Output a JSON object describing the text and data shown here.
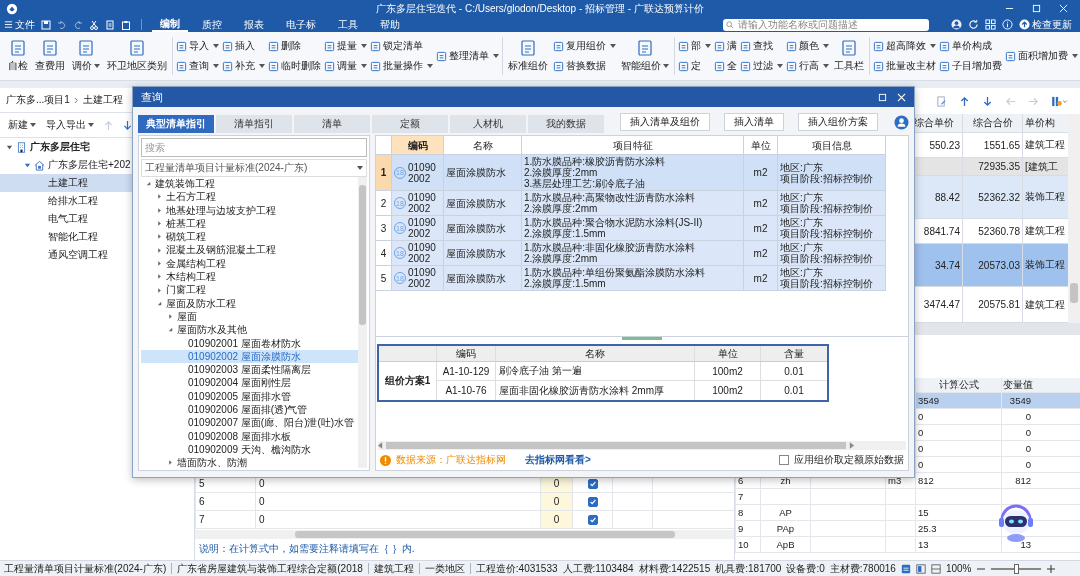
{
  "window": {
    "title": "广东多层住宅迭代 - C:/Users/glodon/Desktop - 招标管理 - 广联达预算计价"
  },
  "menu_bar": {
    "file": "文件",
    "tabs": [
      {
        "label": "编制",
        "selected": true
      },
      {
        "label": "质控",
        "selected": false
      },
      {
        "label": "报表",
        "selected": false
      },
      {
        "label": "电子标",
        "selected": false
      },
      {
        "label": "工具",
        "selected": false
      },
      {
        "label": "帮助",
        "selected": false
      }
    ],
    "search": {
      "placeholder": "请输入功能名称或问题描述"
    },
    "update_button": "检查更新"
  },
  "ribbon": {
    "groups": [
      [
        {
          "kind": "large",
          "label": "自检",
          "dropdown": false
        },
        {
          "kind": "large",
          "label": "查费用",
          "dropdown": false
        },
        {
          "kind": "large",
          "label": "调价",
          "dropdown": true
        },
        {
          "kind": "large",
          "label": "环卫地区类别",
          "dropdown": false
        }
      ],
      [
        {
          "kind": "stack",
          "items": [
            {
              "label": "导入",
              "dropdown": true
            },
            {
              "label": "查询",
              "dropdown": true
            }
          ]
        },
        {
          "kind": "stack",
          "items": [
            {
              "label": "插入",
              "dropdown": false
            },
            {
              "label": "补充",
              "dropdown": true
            }
          ]
        },
        {
          "kind": "stack",
          "items": [
            {
              "label": "删除",
              "dropdown": false
            },
            {
              "label": "临时删除",
              "dropdown": false
            }
          ]
        },
        {
          "kind": "stack",
          "items": [
            {
              "label": "提量",
              "dropdown": true
            },
            {
              "label": "调量",
              "dropdown": true
            }
          ]
        },
        {
          "kind": "stack",
          "items": [
            {
              "label": "锁定清单",
              "dropdown": false
            },
            {
              "label": "批量操作",
              "dropdown": true
            }
          ]
        },
        {
          "kind": "stack",
          "items": [
            {
              "label": "整理清单",
              "dropdown": true
            }
          ]
        }
      ],
      [
        {
          "kind": "large",
          "label": "标准组价",
          "dropdown": false
        },
        {
          "kind": "stack",
          "items": [
            {
              "label": "复用组价",
              "dropdown": true
            },
            {
              "label": "替换数据",
              "dropdown": false
            }
          ]
        },
        {
          "kind": "large",
          "label": "智能组价",
          "dropdown": true
        }
      ],
      [
        {
          "kind": "stack",
          "items": [
            {
              "label": "部",
              "dropdown": true
            },
            {
              "label": "定",
              "dropdown": false
            }
          ]
        },
        {
          "kind": "stack",
          "items": [
            {
              "label": "满",
              "dropdown": false
            },
            {
              "label": "全",
              "dropdown": false
            }
          ]
        },
        {
          "kind": "stack",
          "items": [
            {
              "label": "查找",
              "dropdown": false
            },
            {
              "label": "过滤",
              "dropdown": true
            }
          ]
        },
        {
          "kind": "stack",
          "items": [
            {
              "label": "颜色",
              "dropdown": true
            },
            {
              "label": "行高",
              "dropdown": true
            }
          ]
        },
        {
          "kind": "large",
          "label": "工具栏",
          "dropdown": false
        }
      ],
      [
        {
          "kind": "stack",
          "items": [
            {
              "label": "超高降效",
              "dropdown": true
            },
            {
              "label": "批量改主材",
              "dropdown": false
            }
          ]
        },
        {
          "kind": "stack",
          "items": [
            {
              "label": "单价构成",
              "dropdown": false
            },
            {
              "label": "子目增加费",
              "dropdown": false
            }
          ]
        },
        {
          "kind": "stack",
          "items": [
            {
              "label": "面积增加费",
              "dropdown": true
            }
          ]
        }
      ]
    ]
  },
  "project": {
    "breadcrumb": [
      "广东多...项目1",
      "土建工程"
    ],
    "new_button": "新建",
    "import_button": "导入导出",
    "tree": [
      {
        "label": "广东多层住宅",
        "kind": "building",
        "expanded": true,
        "selected": false,
        "children": [
          {
            "label": "广东多层住宅+202",
            "kind": "house",
            "expanded": true,
            "selected": false,
            "children": [
              {
                "label": "土建工程",
                "selected": true
              },
              {
                "label": "给排水工程",
                "selected": false
              },
              {
                "label": "电气工程",
                "selected": false
              },
              {
                "label": "智能化工程",
                "selected": false
              },
              {
                "label": "通风空调工程",
                "selected": false
              }
            ]
          }
        ]
      }
    ]
  },
  "price_table": {
    "columns": [
      "综合单价",
      "综合合价",
      "单价构"
    ],
    "rows": [
      {
        "kind": "quota",
        "selected": false,
        "price": "550.23",
        "total": "1551.65",
        "type": "建筑工程"
      },
      {
        "kind": "section",
        "selected": false,
        "price": "",
        "total": "72935.35",
        "type": "[建筑工"
      },
      {
        "kind": "item",
        "selected": false,
        "price": "88.42",
        "total": "52362.32",
        "type": "装饰工程"
      },
      {
        "kind": "quota",
        "selected": false,
        "price": "8841.74",
        "total": "52360.78",
        "type": "建筑工程"
      },
      {
        "kind": "item",
        "selected": true,
        "price": "34.74",
        "total": "20573.03",
        "type": "装饰工程"
      },
      {
        "kind": "quota",
        "selected": false,
        "price": "3474.47",
        "total": "20575.81",
        "type": "建筑工程"
      }
    ]
  },
  "formula_rows": {
    "rows": [
      {
        "index": "5",
        "formula": "0",
        "value": "0",
        "checked": true
      },
      {
        "index": "6",
        "formula": "0",
        "value": "0",
        "checked": true
      },
      {
        "index": "7",
        "formula": "0",
        "value": "0",
        "checked": true
      }
    ],
    "note": "说明：在计算式中，如需要注释请填写在｛ ｝内."
  },
  "variables": {
    "columns": [
      "计算公式",
      "变量值"
    ],
    "rows": [
      {
        "selected": true,
        "formula": "3549",
        "value": "3549"
      },
      {
        "selected": false,
        "formula": "0",
        "value": "0"
      },
      {
        "selected": false,
        "formula": "0",
        "value": "0"
      },
      {
        "selected": false,
        "formula": "0",
        "value": "0"
      },
      {
        "selected": false,
        "formula": "0",
        "value": "0"
      },
      {
        "selected": false,
        "index": "6",
        "name": "zh",
        "unit": "m3",
        "formula": "812",
        "value": "812"
      },
      {
        "selected": false,
        "index": "7"
      },
      {
        "selected": false,
        "index": "8",
        "name": "AP",
        "formula": "15"
      },
      {
        "selected": false,
        "index": "9",
        "name": "PAp",
        "formula": "25.3"
      },
      {
        "selected": false,
        "index": "10",
        "name": "ApB",
        "formula": "13",
        "value": "13"
      }
    ]
  },
  "dialog": {
    "title": "查询",
    "tabs": [
      {
        "label": "典型清单指引",
        "selected": true
      },
      {
        "label": "清单指引",
        "selected": false
      },
      {
        "label": "清单",
        "selected": false
      },
      {
        "label": "定额",
        "selected": false
      },
      {
        "label": "人材机",
        "selected": false
      },
      {
        "label": "我的数据",
        "selected": false
      }
    ],
    "actions": [
      "插入清单及组价",
      "插入清单",
      "插入组价方案"
    ],
    "search": {
      "placeholder": "搜索"
    },
    "standard": "工程量清单项目计量标准(2024-广东)",
    "tree": [
      {
        "label": "建筑装饰工程",
        "expanded": true,
        "selected": false,
        "children": [
          {
            "label": "土石方工程",
            "expanded": false,
            "selected": false
          },
          {
            "label": "地基处理与边坡支护工程",
            "expanded": false,
            "selected": false
          },
          {
            "label": "桩基工程",
            "expanded": false,
            "selected": false
          },
          {
            "label": "砌筑工程",
            "expanded": false,
            "selected": false
          },
          {
            "label": "混凝土及钢筋混凝土工程",
            "expanded": false,
            "selected": false
          },
          {
            "label": "金属结构工程",
            "expanded": false,
            "selected": false
          },
          {
            "label": "木结构工程",
            "expanded": false,
            "selected": false
          },
          {
            "label": "门窗工程",
            "expanded": false,
            "selected": false
          },
          {
            "label": "屋面及防水工程",
            "expanded": true,
            "selected": false,
            "children": [
              {
                "label": "屋面",
                "expanded": false,
                "selected": false
              },
              {
                "label": "屋面防水及其他",
                "expanded": true,
                "selected": false,
                "children": [
                  {
                    "label": "010902001 屋面卷材防水",
                    "selected": false
                  },
                  {
                    "label": "010902002 屋面涂膜防水",
                    "selected": true
                  },
                  {
                    "label": "010902003 屋面柔性隔离层",
                    "selected": false
                  },
                  {
                    "label": "010902004 屋面刚性层",
                    "selected": false
                  },
                  {
                    "label": "010902005 屋面排水管",
                    "selected": false
                  },
                  {
                    "label": "010902006 屋面排(透)气管",
                    "selected": false
                  },
                  {
                    "label": "010902007 屋面(廊、阳台)泄(吐)水管",
                    "selected": false
                  },
                  {
                    "label": "010902008 屋面排水板",
                    "selected": false
                  },
                  {
                    "label": "010902009 天沟、檐沟防水",
                    "selected": false
                  }
                ]
              },
              {
                "label": "墙面防水、防潮",
                "expanded": false,
                "selected": false
              }
            ]
          }
        ]
      }
    ],
    "items": {
      "columns": [
        "编码",
        "名称",
        "项目特征",
        "单位",
        "项目信息"
      ],
      "rows": [
        {
          "index": "1",
          "selected": true,
          "badge": "18",
          "code": "010902002",
          "name": "屋面涂膜防水",
          "features": [
            "1.防水膜品种:橡胶沥青防水涂料",
            "2.涂膜厚度:2mm",
            "3.基层处理工艺:刷冷底子油"
          ],
          "unit": "m2",
          "info": [
            "地区:广东",
            "项目阶段:招标控制价"
          ]
        },
        {
          "index": "2",
          "selected": false,
          "badge": "18",
          "code": "010902002",
          "name": "屋面涂膜防水",
          "features": [
            "1.防水膜品种:高聚物改性沥青防水涂料",
            "2.涂膜厚度:2mm"
          ],
          "unit": "m2",
          "info": [
            "地区:广东",
            "项目阶段:招标控制价"
          ]
        },
        {
          "index": "3",
          "selected": false,
          "badge": "18",
          "code": "010902002",
          "name": "屋面涂膜防水",
          "features": [
            "1.防水膜品种:聚合物水泥防水涂料(JS-II)",
            "2.涂膜厚度:1.5mm"
          ],
          "unit": "m2",
          "info": [
            "地区:广东",
            "项目阶段:招标控制价"
          ]
        },
        {
          "index": "4",
          "selected": false,
          "badge": "18",
          "code": "010902002",
          "name": "屋面涂膜防水",
          "features": [
            "1.防水膜品种:非固化橡胶沥青防水涂料",
            "2.涂膜厚度:2mm"
          ],
          "unit": "m2",
          "info": [
            "地区:广东",
            "项目阶段:招标控制价"
          ]
        },
        {
          "index": "5",
          "selected": false,
          "badge": "18",
          "code": "010902002",
          "name": "屋面涂膜防水",
          "features": [
            "1.防水膜品种:单组份聚氨酯涂膜防水涂料",
            "2.涂膜厚度:1.5mm"
          ],
          "unit": "m2",
          "info": [
            "地区:广东",
            "项目阶段:招标控制价"
          ]
        }
      ]
    },
    "scheme": {
      "label": "组价方案1",
      "columns": [
        "编码",
        "名称",
        "单位",
        "含量"
      ],
      "rows": [
        {
          "code": "A1-10-129",
          "name": "刷冷底子油 第一遍",
          "unit": "100m2",
          "amount": "0.01"
        },
        {
          "code": "A1-10-76",
          "name": "屋面非固化橡胶沥青防水涂料 2mm厚",
          "unit": "100m2",
          "amount": "0.01"
        }
      ]
    },
    "source": "数据来源：广联达指标网",
    "link": "去指标网看看>",
    "option": {
      "label": "应用组价取定额原始数据",
      "checked": false
    }
  },
  "status_bar": {
    "items": [
      "工程量清单项目计量标准(2024-广东)",
      "广东省房屋建筑与装饰工程综合定额(2018",
      "建筑工程",
      "一类地区"
    ],
    "costs": [
      "工程造价:4031533",
      "人工费:1103484",
      "材料费:1422515",
      "机具费:181700",
      "设备费:0",
      "主材费:780016"
    ],
    "zoom": "100%",
    "zoom_slider": {
      "level": 0.5
    }
  }
}
